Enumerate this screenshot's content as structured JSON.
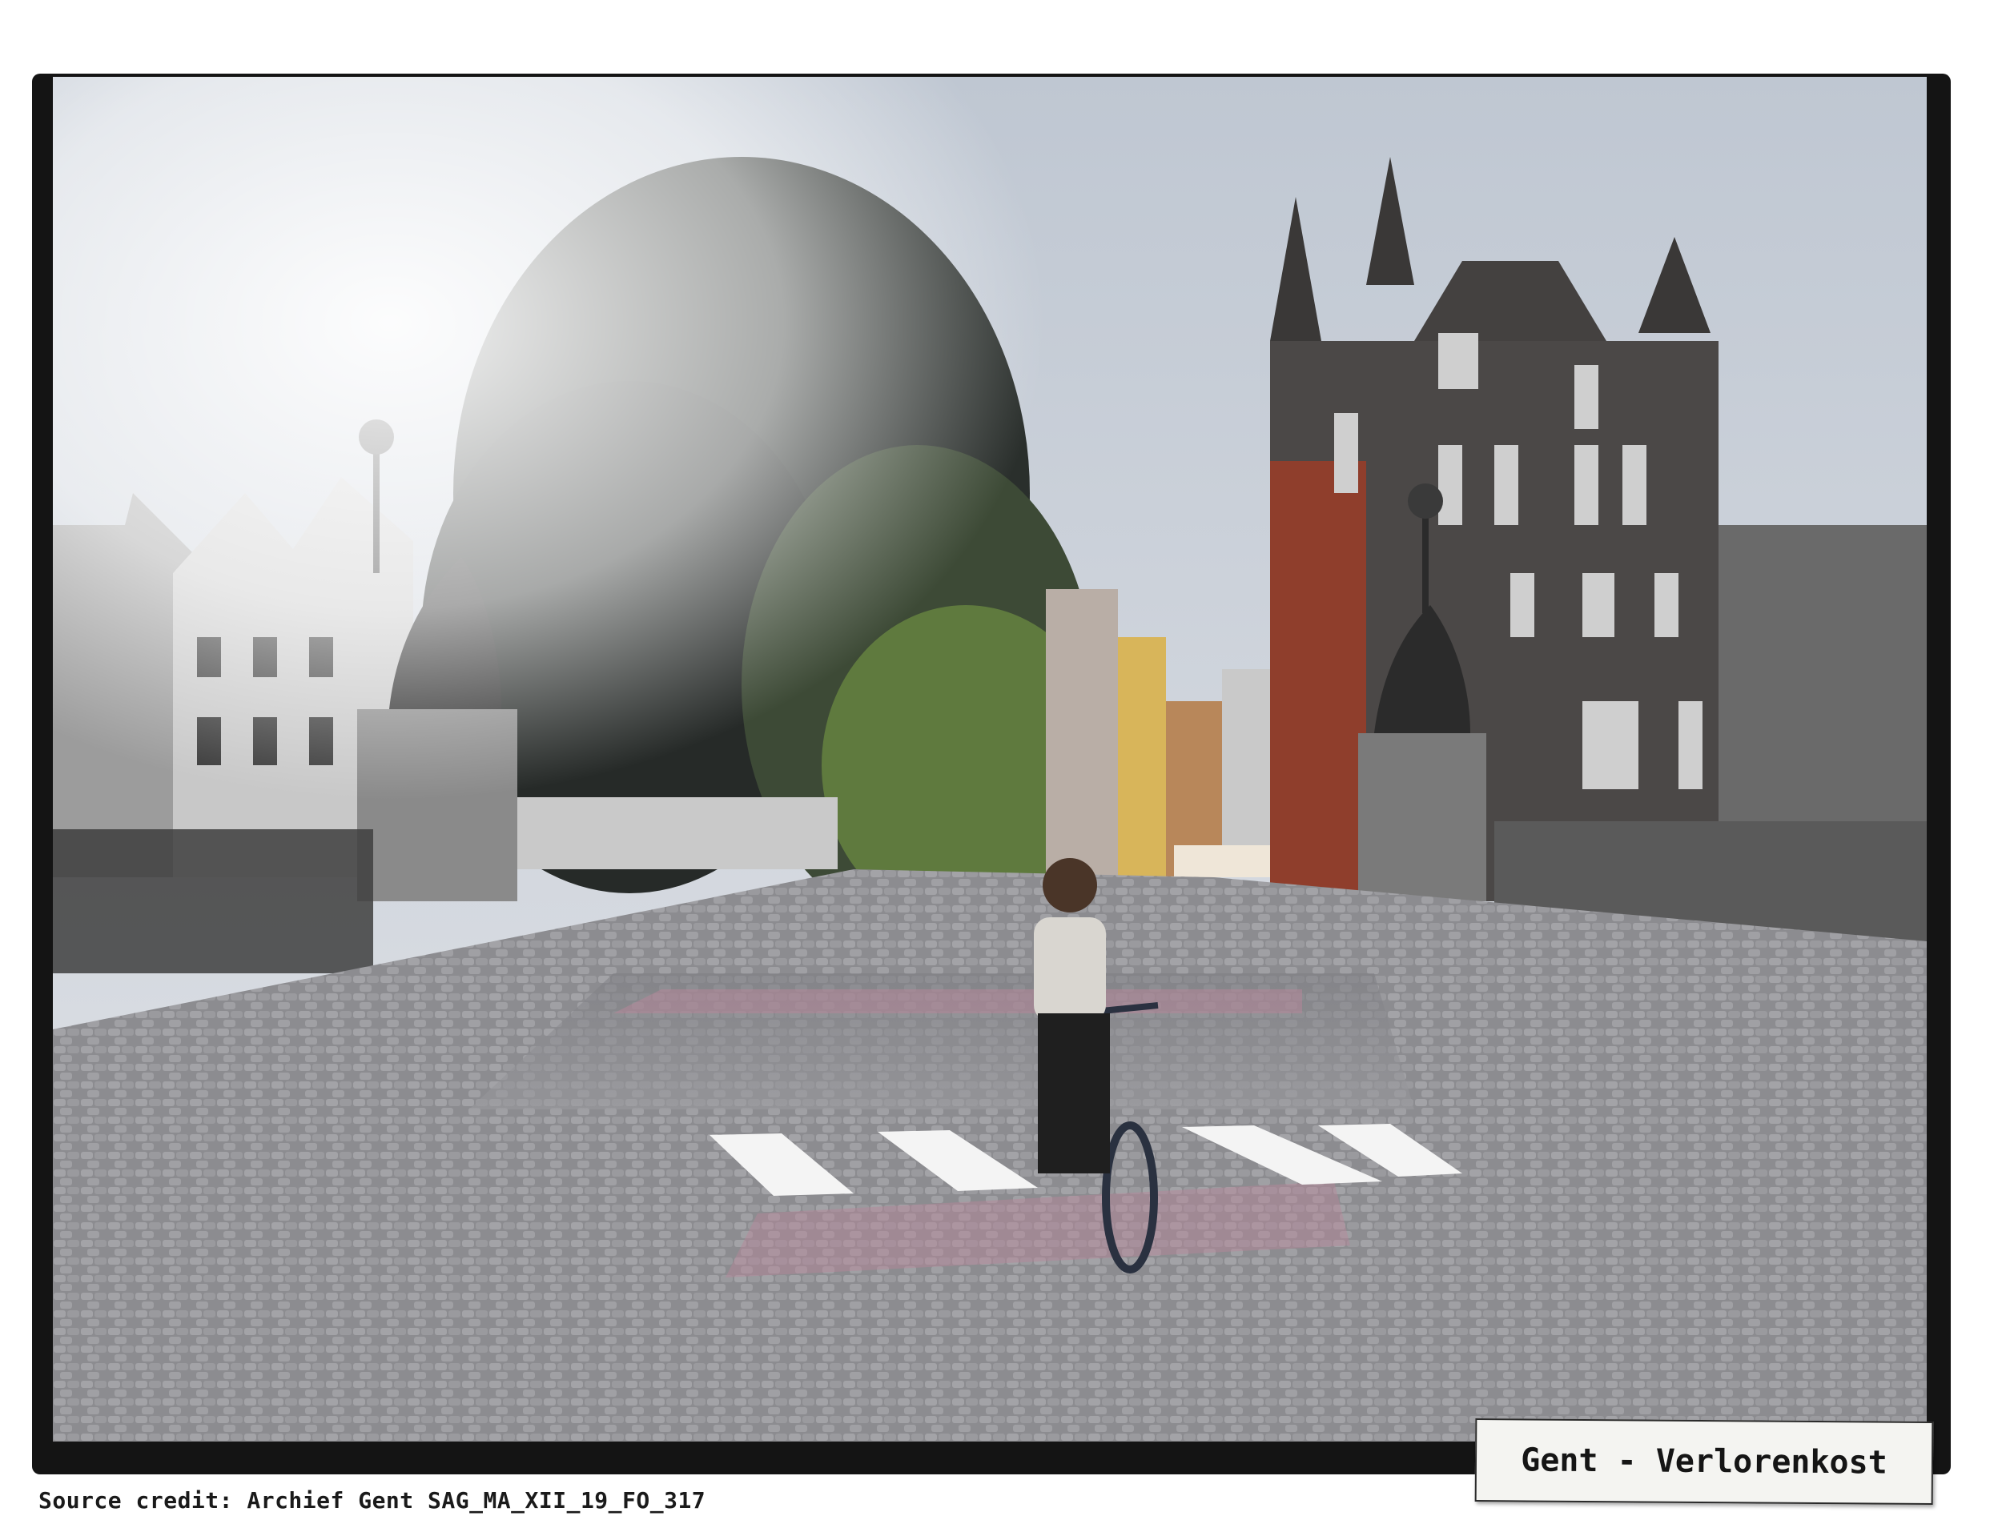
{
  "caption": {
    "label": "Gent - Verlorenkost"
  },
  "credit": {
    "text": "Source credit: Archief Gent SAG_MA_XII_19_FO_317"
  },
  "colors": {
    "sky": "#cfd6df",
    "foliage_dark": "#2a2f2c",
    "foliage_green": "#5f7a3e",
    "cobbles": "#8e8e92",
    "crosswalk": "#f4f4f4",
    "bike_lane": "#b7869a",
    "brick": "#8f3e2c",
    "frame": "#141414"
  }
}
